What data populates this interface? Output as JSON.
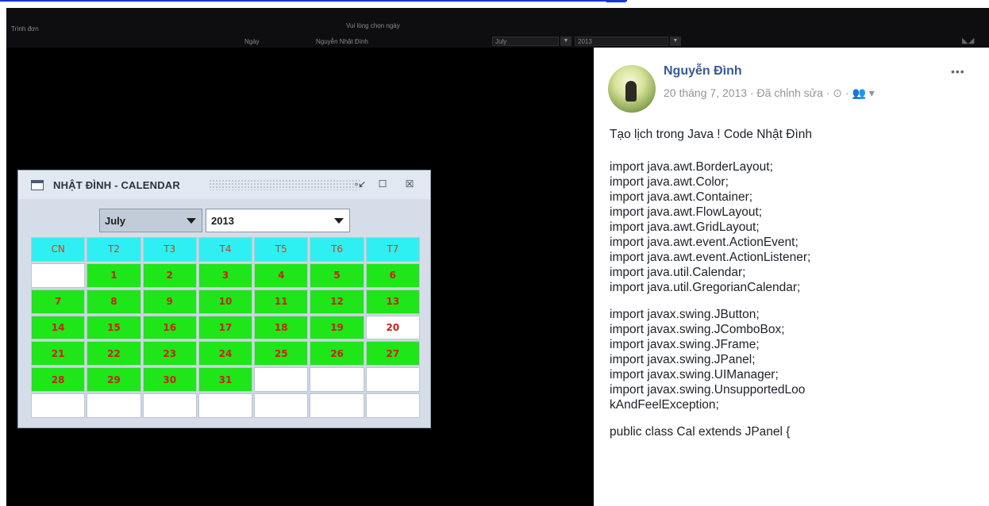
{
  "background_bar": {
    "labels": [
      "Trình đơn",
      "Ngày",
      "Nguyễn Nhật Đình",
      "Vui lòng chọn ngày"
    ],
    "fields": [
      "July",
      "2013"
    ]
  },
  "java_window": {
    "title": "NHẬT ĐÌNH - CALENDAR",
    "buttons": [
      "minimize",
      "maximize",
      "close"
    ],
    "month_value": "July",
    "year_value": "2013",
    "weekday_headers": [
      "CN",
      "T2",
      "T3",
      "T4",
      "T5",
      "T6",
      "T7"
    ],
    "weeks": [
      [
        "",
        "1",
        "2",
        "3",
        "4",
        "5",
        "6"
      ],
      [
        "7",
        "8",
        "9",
        "10",
        "11",
        "12",
        "13"
      ],
      [
        "14",
        "15",
        "16",
        "17",
        "18",
        "19",
        "20"
      ],
      [
        "21",
        "22",
        "23",
        "24",
        "25",
        "26",
        "27"
      ],
      [
        "28",
        "29",
        "30",
        "31",
        "",
        "",
        ""
      ],
      [
        "",
        "",
        "",
        "",
        "",
        "",
        ""
      ]
    ],
    "today": "20",
    "colors": {
      "header_bg": "#2ef0f2",
      "day_bg": "#1ee619",
      "day_text": "#cc2018"
    }
  },
  "post": {
    "author": "Nguyễn Đình",
    "meta": "20 tháng 7, 2013 · Đã chỉnh sửa · ⊙ · 👥 ▾",
    "more_icon": "more-dots-icon",
    "caption": "Tạo lịch trong Java ! Code Nhật Đình",
    "code_block_1": [
      "import java.awt.BorderLayout;",
      "import java.awt.Color;",
      "import java.awt.Container;",
      "import java.awt.FlowLayout;",
      "import java.awt.GridLayout;",
      "import java.awt.event.ActionEvent;",
      "import java.awt.event.ActionListener;",
      "import java.util.Calendar;",
      "import java.util.GregorianCalendar;"
    ],
    "code_block_2": [
      "import javax.swing.JButton;",
      "import javax.swing.JComboBox;",
      "import javax.swing.JFrame;",
      "import javax.swing.JPanel;",
      "import javax.swing.UIManager;",
      "import javax.swing.UnsupportedLoo",
      "kAndFeelException;"
    ],
    "code_block_3": [
      "public class Cal extends JPanel {"
    ]
  }
}
